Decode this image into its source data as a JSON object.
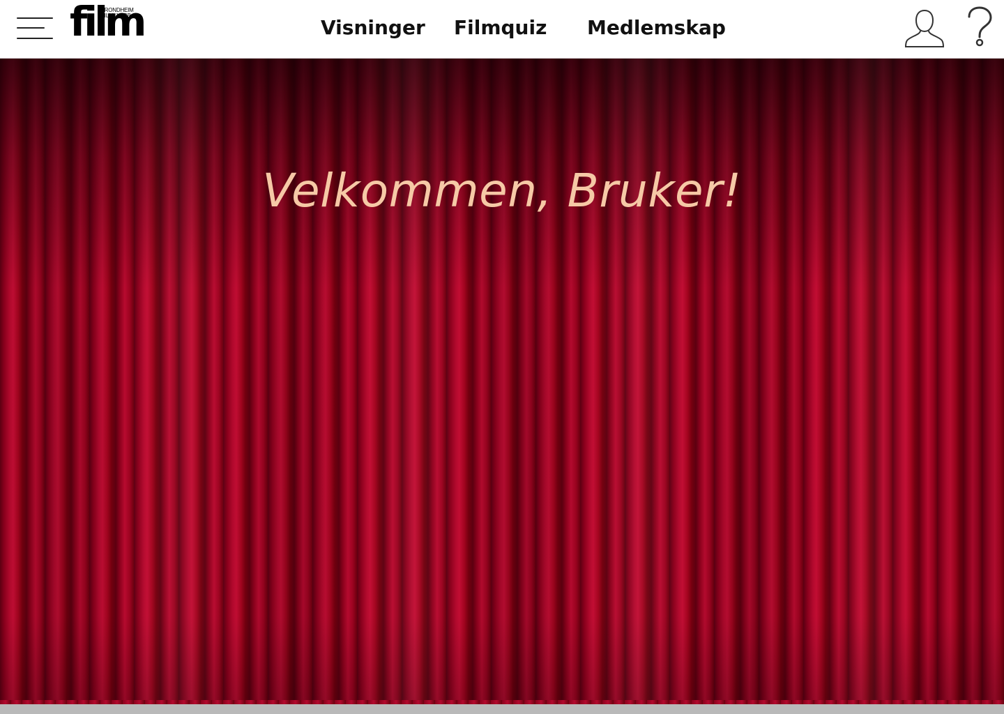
{
  "header": {
    "logo": {
      "word": "film",
      "line1": "TRONDHEIM",
      "line2": "FILMKLUBB"
    },
    "nav": [
      {
        "label": "Visninger"
      },
      {
        "label": "Filmquiz"
      },
      {
        "label": "Medlemskap"
      }
    ],
    "icons": {
      "menu": "hamburger-menu-icon",
      "user": "user-icon",
      "help": "question-mark-icon"
    }
  },
  "main": {
    "welcome_text": "Velkommen, Bruker!",
    "background": "red-theater-curtain"
  },
  "colors": {
    "curtain": "#a3041f",
    "welcome_text": "#f6c9a6",
    "header_bg": "#ffffff",
    "nav_text": "#111111",
    "floor": "#b9b9b9"
  }
}
